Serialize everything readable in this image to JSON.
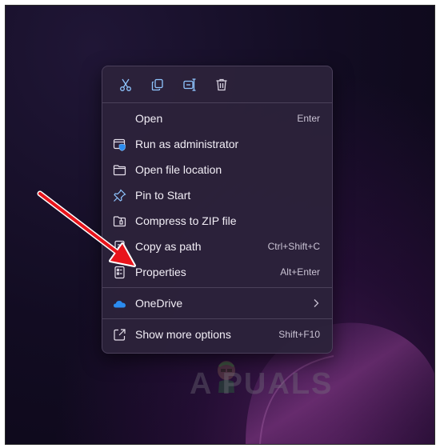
{
  "toolbar": {
    "cut_icon": "scissors-icon",
    "copy_icon": "copy-icon",
    "rename_icon": "rename-icon",
    "delete_icon": "trash-icon"
  },
  "menu": {
    "items": [
      {
        "label": "Open",
        "shortcut": "Enter",
        "icon": "none"
      },
      {
        "label": "Run as administrator",
        "shortcut": "",
        "icon": "shield-window-icon"
      },
      {
        "label": "Open file location",
        "shortcut": "",
        "icon": "folder-icon"
      },
      {
        "label": "Pin to Start",
        "shortcut": "",
        "icon": "pin-icon"
      },
      {
        "label": "Compress to ZIP file",
        "shortcut": "",
        "icon": "zip-folder-icon"
      },
      {
        "label": "Copy as path",
        "shortcut": "Ctrl+Shift+C",
        "icon": "copy-path-icon"
      },
      {
        "label": "Properties",
        "shortcut": "Alt+Enter",
        "icon": "properties-icon"
      }
    ],
    "onedrive": {
      "label": "OneDrive",
      "icon": "onedrive-cloud-icon"
    },
    "more": {
      "label": "Show more options",
      "shortcut": "Shift+F10",
      "icon": "share-arrow-icon"
    }
  },
  "watermark": {
    "text": "A  PUALS"
  },
  "colors": {
    "accent_icon": "#8fc5ff",
    "arrow": "#e8141b",
    "onedrive": "#2b8cf0"
  }
}
